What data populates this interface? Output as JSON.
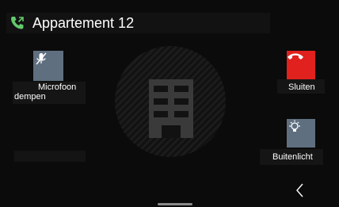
{
  "header": {
    "title": "Appartement 12",
    "icon": "phone-call-icon",
    "icon_color": "#63c96b"
  },
  "actions": {
    "mute": {
      "label_line1": "Microfoon",
      "label_line2": "dempen",
      "icon": "microphone-off-icon",
      "color": "#5f6f80"
    },
    "end_call": {
      "label": "Sluiten",
      "icon": "phone-hangup-icon",
      "color": "#e0211d"
    },
    "outdoor_light": {
      "label": "Buitenlicht",
      "icon": "lightbulb-icon",
      "color": "#5f6f80"
    }
  },
  "caller_avatar": {
    "icon": "building-icon"
  },
  "nav": {
    "back_icon": "chevron-left-icon"
  }
}
